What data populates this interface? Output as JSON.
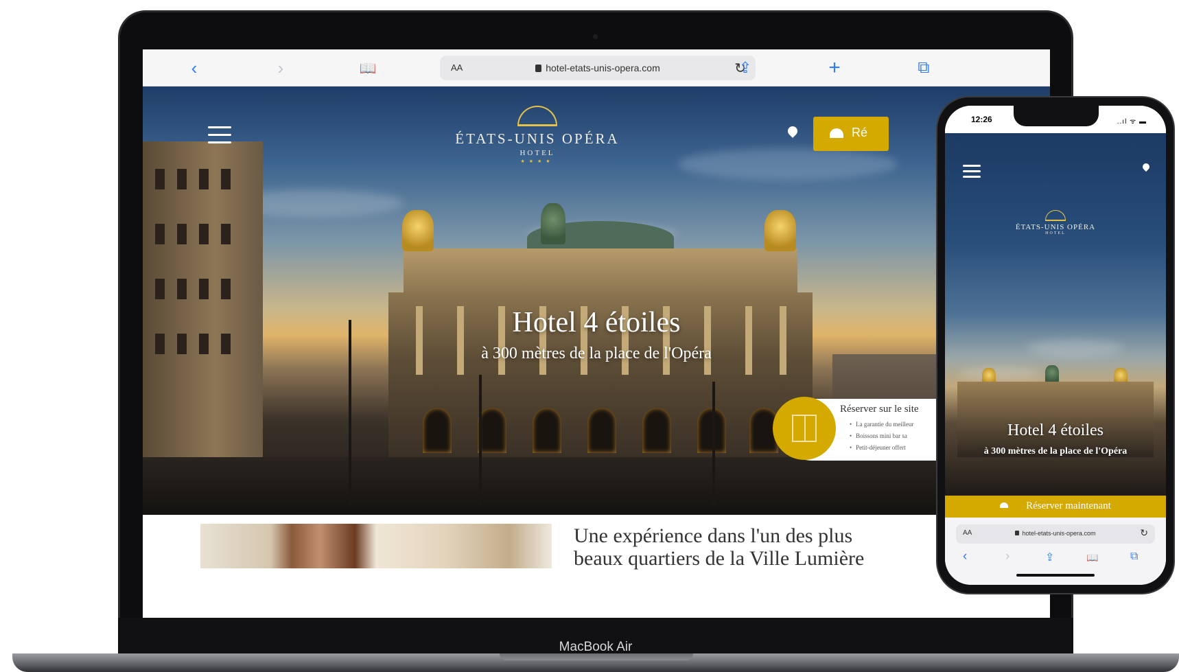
{
  "laptop": {
    "model_label": "MacBook Air",
    "browser": {
      "back_icon": "‹",
      "forward_icon": "›",
      "bookmarks_icon": "📖",
      "text_size_label": "AA",
      "url": "hotel-etats-unis-opera.com",
      "reload_icon": "↻",
      "share_icon": "⇪",
      "new_tab_icon": "+",
      "tabs_icon": "⧉"
    },
    "hero": {
      "logo_name": "ÉTATS-UNIS OPÉRA",
      "logo_sub": "HOTEL",
      "logo_stars": "★★★★",
      "book_button_label": "Ré",
      "title": "Hotel 4 étoiles",
      "subtitle": "à 300 mètres de la place de l'Opéra",
      "promo": {
        "title": "Réserver sur le site",
        "items": [
          "La garantie du meilleur",
          "Boissons mini bar sa",
          "Petit-déjeuner offert"
        ]
      }
    },
    "section": {
      "title_line1": "Une expérience dans l'un des plus",
      "title_line2": "beaux quartiers de la Ville Lumière"
    }
  },
  "phone": {
    "time": "12:26",
    "signal": "..ıl ᯤ ▬",
    "logo_name": "ÉTATS-UNIS OPÉRA",
    "logo_sub": "HOTEL",
    "title": "Hotel 4 étoiles",
    "subtitle": "à 300 mètres de la place de l'Opéra",
    "book_button_label": "Réserver maintenant",
    "browser": {
      "text_size_label": "AA",
      "url": "hotel-etats-unis-opera.com",
      "reload_icon": "↻",
      "back_icon": "‹",
      "forward_icon": "›",
      "share_icon": "⇪",
      "bookmarks_icon": "📖",
      "tabs_icon": "⧉"
    }
  },
  "colors": {
    "accent_gold": "#d4a900",
    "safari_blue": "#2f7cf6"
  }
}
